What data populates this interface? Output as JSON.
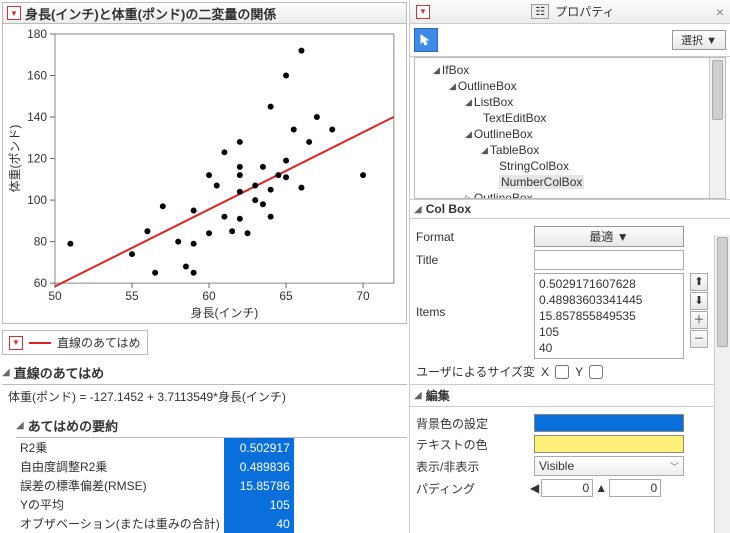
{
  "left": {
    "title": "身長(インチ)と体重(ポンド)の二変量の関係",
    "xlabel": "身長(インチ)",
    "ylabel": "体重(ポンド)",
    "legend": "直線のあてはめ",
    "section_fit": "直線のあてはめ",
    "equation": "体重(ポンド) = -127.1452 + 3.7113549*身長(インチ)",
    "section_summary": "あてはめの要約",
    "stats": [
      {
        "label": "R2乗",
        "value": "0.502917"
      },
      {
        "label": "自由度調整R2乗",
        "value": "0.489836"
      },
      {
        "label": "誤差の標準偏差(RMSE)",
        "value": "15.85786"
      },
      {
        "label": "Yの平均",
        "value": "105"
      },
      {
        "label": "オブザベーション(または重みの合計)",
        "value": "40"
      }
    ]
  },
  "right": {
    "panel_title": "プロパティ",
    "select_btn": "選択 ▼",
    "tree": [
      {
        "indent": 1,
        "tri": "◢",
        "label": "IfBox"
      },
      {
        "indent": 2,
        "tri": "◢",
        "label": "OutlineBox"
      },
      {
        "indent": 3,
        "tri": "◢",
        "label": "ListBox"
      },
      {
        "indent": 4,
        "tri": "",
        "label": "TextEditBox"
      },
      {
        "indent": 3,
        "tri": "◢",
        "label": "OutlineBox"
      },
      {
        "indent": 4,
        "tri": "◢",
        "label": "TableBox"
      },
      {
        "indent": 5,
        "tri": "",
        "label": "StringColBox"
      },
      {
        "indent": 5,
        "tri": "",
        "label": "NumberColBox",
        "hl": true
      },
      {
        "indent": 3,
        "tri": "▷",
        "label": "OutlineBox"
      }
    ],
    "colbox_head": "Col Box",
    "format_label": "Format",
    "format_btn": "最適 ▼",
    "title_label": "Title",
    "title_value": "",
    "items_label": "Items",
    "items": [
      "0.5029171607628",
      "0.48983603341445",
      "15.857855849535",
      "105",
      "40"
    ],
    "usersize_label": "ユーザによるサイズ変",
    "x_label": "X",
    "y_label": "Y",
    "edit_head": "編集",
    "bgcolor_label": "背景色の設定",
    "bgcolor": "#0a6edb",
    "textcolor_label": "テキストの色",
    "textcolor": "#fff07a",
    "vis_label": "表示/非表示",
    "vis_value": "Visible",
    "pad_label": "パディング",
    "pad_left": "0",
    "pad_top": "0"
  },
  "chart_data": {
    "type": "scatter",
    "title": "身長(インチ)と体重(ポンド)の二変量の関係",
    "xlabel": "身長(インチ)",
    "ylabel": "体重(ポンド)",
    "xlim": [
      50,
      72
    ],
    "ylim": [
      60,
      180
    ],
    "xticks": [
      50,
      55,
      60,
      65,
      70
    ],
    "yticks": [
      60,
      80,
      100,
      120,
      140,
      160,
      180
    ],
    "fit": {
      "intercept": -127.1452,
      "slope": 3.7113549
    },
    "points": [
      [
        51,
        79
      ],
      [
        55,
        74
      ],
      [
        56,
        85
      ],
      [
        56.5,
        65
      ],
      [
        57,
        97
      ],
      [
        58,
        80
      ],
      [
        58.5,
        68
      ],
      [
        59,
        95
      ],
      [
        59,
        79
      ],
      [
        59,
        65
      ],
      [
        60,
        112
      ],
      [
        60,
        84
      ],
      [
        60.5,
        107
      ],
      [
        61,
        123
      ],
      [
        61,
        92
      ],
      [
        61.5,
        85
      ],
      [
        62,
        112
      ],
      [
        62,
        128
      ],
      [
        62,
        116
      ],
      [
        62,
        104
      ],
      [
        62,
        91
      ],
      [
        62.5,
        84
      ],
      [
        63,
        107
      ],
      [
        63,
        100
      ],
      [
        63.5,
        116
      ],
      [
        63.5,
        98
      ],
      [
        64,
        145
      ],
      [
        64,
        105
      ],
      [
        64,
        92
      ],
      [
        64.5,
        112
      ],
      [
        65,
        119
      ],
      [
        65,
        111
      ],
      [
        65,
        160
      ],
      [
        65.5,
        134
      ],
      [
        66,
        106
      ],
      [
        66,
        172
      ],
      [
        66.5,
        128
      ],
      [
        67,
        140
      ],
      [
        68,
        134
      ],
      [
        70,
        112
      ]
    ]
  }
}
